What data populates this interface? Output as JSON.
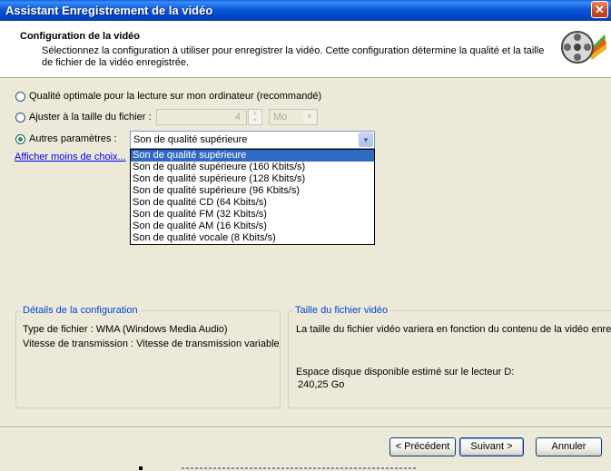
{
  "window": {
    "title": "Assistant Enregistrement de la vidéo",
    "close_symbol": "✕"
  },
  "header": {
    "heading": "Configuration de la vidéo",
    "description": "Sélectionnez la configuration à utiliser pour enregistrer la vidéo. Cette configuration détermine la qualité et la taille de fichier de la vidéo enregistrée.",
    "icon": "film-reel-icon"
  },
  "options": {
    "optimal_label": "Qualité optimale pour la lecture sur mon ordinateur (recommandé)",
    "filesize_label": "Ajuster à la taille du fichier :",
    "filesize_value": "4",
    "filesize_unit": "Mo",
    "other_label": "Autres paramètres :",
    "selected": "other"
  },
  "combo": {
    "value": "Son de qualité supérieure",
    "items": [
      "Son de qualité supérieure",
      "Son de qualité supérieure (160 Kbits/s)",
      "Son de qualité supérieure (128 Kbits/s)",
      "Son de qualité supérieure (96 Kbits/s)",
      "Son de qualité CD (64 Kbits/s)",
      "Son de qualité FM (32 Kbits/s)",
      "Son de qualité AM (16 Kbits/s)",
      "Son de qualité vocale (8 Kbits/s)"
    ],
    "highlighted_index": 0
  },
  "link": {
    "text": "Afficher moins de choix..."
  },
  "details": {
    "legend": "Détails de la configuration",
    "file_type": "Type de fichier : WMA (Windows Media Audio)",
    "bitrate": "Vitesse de transmission : Vitesse de transmission variable"
  },
  "filesize_panel": {
    "legend": "Taille du fichier vidéo",
    "text": "La taille du fichier vidéo variera en fonction du contenu de la vidéo enreg",
    "disk_label": "Espace disque disponible estimé sur le lecteur D:",
    "disk_value": "240,25 Go"
  },
  "buttons": {
    "previous": "< Précédent",
    "next": "Suivant >",
    "cancel": "Annuler"
  },
  "colors": {
    "titlebar": "#0a58d8",
    "selection": "#316ac5",
    "legend_text": "#0046d5"
  }
}
